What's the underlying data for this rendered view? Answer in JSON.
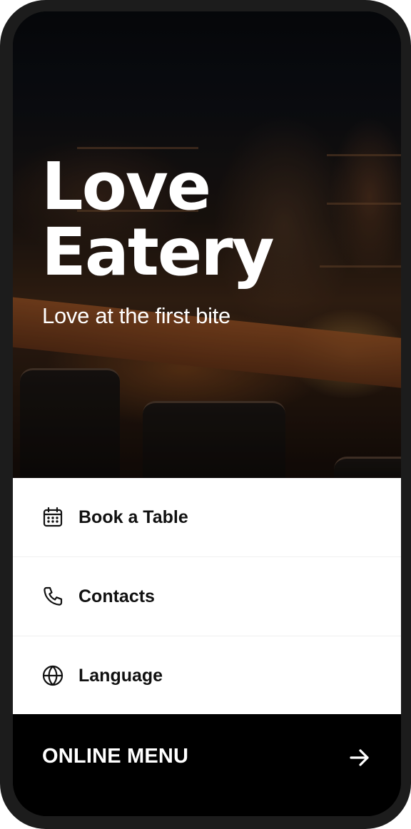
{
  "brand": {
    "name_line1": "Love",
    "name_line2": "Eatery",
    "tagline": "Love at the first bite"
  },
  "menu": {
    "items": [
      {
        "label": "Book a Table",
        "icon": "calendar-icon"
      },
      {
        "label": "Contacts",
        "icon": "phone-icon"
      },
      {
        "label": "Language",
        "icon": "globe-icon"
      }
    ]
  },
  "cta": {
    "label": "ONLINE MENU",
    "icon": "arrow-right-icon"
  },
  "colors": {
    "frame": "#1c1c1c",
    "menu_background": "#ffffff",
    "menu_text": "#111111",
    "cta_background": "#000000",
    "cta_text": "#ffffff",
    "hero_text": "#ffffff"
  }
}
